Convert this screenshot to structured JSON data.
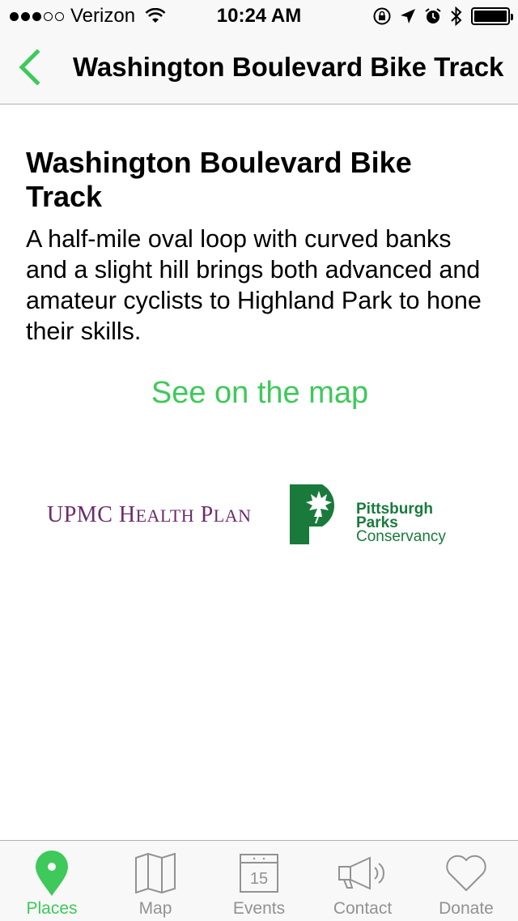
{
  "status_bar": {
    "carrier": "Verizon",
    "time": "10:24 AM",
    "signal_bars_filled": 3,
    "signal_bars_total": 5,
    "battery_level": 0.9
  },
  "nav": {
    "title": "Washington Boulevard Bike Track",
    "back_icon": "chevron-left-icon"
  },
  "place": {
    "title": "Washington Boulevard Bike Track",
    "description": "A half-mile oval loop with curved banks and a slight hill brings both advanced and amateur cyclists to Highland Park to hone their skills.",
    "map_link": "See on the map"
  },
  "sponsors": {
    "upmc": {
      "text_first": "UPMC H",
      "text_small1": "EALTH",
      "text_mid": " P",
      "text_small2": "LAN"
    },
    "ppc": {
      "line1": "Pittsburgh",
      "line2": "Parks",
      "line3": "Conservancy"
    }
  },
  "tabs": [
    {
      "label": "Places",
      "icon": "map-pin-icon",
      "active": true
    },
    {
      "label": "Map",
      "icon": "folded-map-icon",
      "active": false
    },
    {
      "label": "Events",
      "icon": "calendar-icon",
      "active": false,
      "badge": "15"
    },
    {
      "label": "Contact",
      "icon": "megaphone-icon",
      "active": false
    },
    {
      "label": "Donate",
      "icon": "heart-icon",
      "active": false
    }
  ],
  "colors": {
    "accent": "#3ec95a",
    "upmc_purple": "#6b2b6d",
    "ppc_green": "#1a7a3c",
    "inactive_tab": "#929292"
  }
}
